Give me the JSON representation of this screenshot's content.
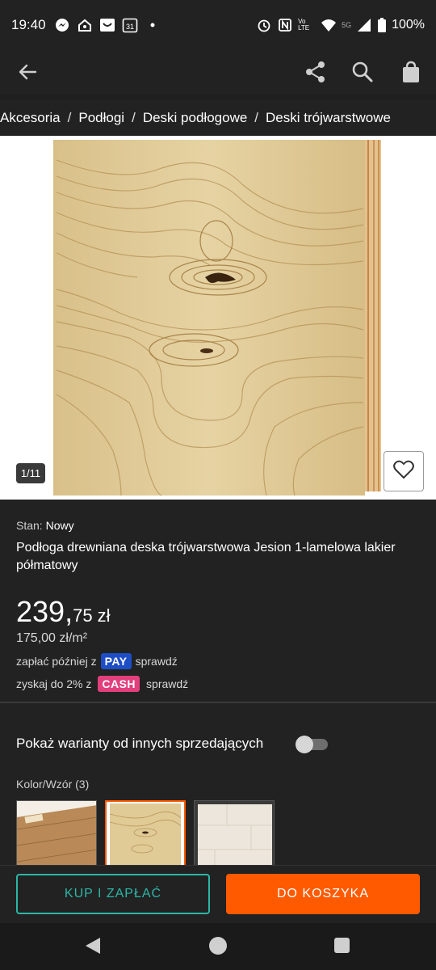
{
  "status_bar": {
    "time": "19:40",
    "battery": "100%",
    "network": "5G",
    "volte": "Vo LTE",
    "calendar_day": "31"
  },
  "app_bar": {
    "back_icon": "arrow-left-icon",
    "share_icon": "share-icon",
    "search_icon": "search-icon",
    "bag_icon": "shopping-bag-icon"
  },
  "breadcrumb": {
    "items": [
      "Akcesoria",
      "Podłogi",
      "Deski podłogowe",
      "Deski trójwarstwowe"
    ],
    "separator": "/"
  },
  "gallery": {
    "counter": "1/11",
    "favorite_icon": "heart-icon"
  },
  "product": {
    "condition_label": "Stan:",
    "condition_value": "Nowy",
    "title": "Podłoga drewniana deska trójwarstwowa Jesion 1-lamelowa lakier półmatowy",
    "price_main": "239,",
    "price_cents": "75",
    "price_currency": "zł",
    "unit_price": "175,00 zł/m²",
    "pay_prefix": "zapłać później z",
    "pay_badge": "PAY",
    "pay_link": "sprawdź",
    "cash_prefix": "zyskaj do 2% z",
    "cash_badge": "CASH",
    "cash_link": "sprawdź"
  },
  "variants": {
    "toggle_label": "Pokaż warianty od innych sprzedających",
    "toggle_on": false,
    "label": "Kolor/Wzór (3)",
    "selected_index": 1
  },
  "actions": {
    "buy_label": "KUP I ZAPŁAĆ",
    "cart_label": "DO KOSZYKA"
  },
  "colors": {
    "accent_orange": "#ff5a00",
    "accent_teal": "#2cb7a6",
    "pay_blue": "#1d4ec6",
    "cash_pink": "#e23f7d",
    "background": "#222222"
  }
}
